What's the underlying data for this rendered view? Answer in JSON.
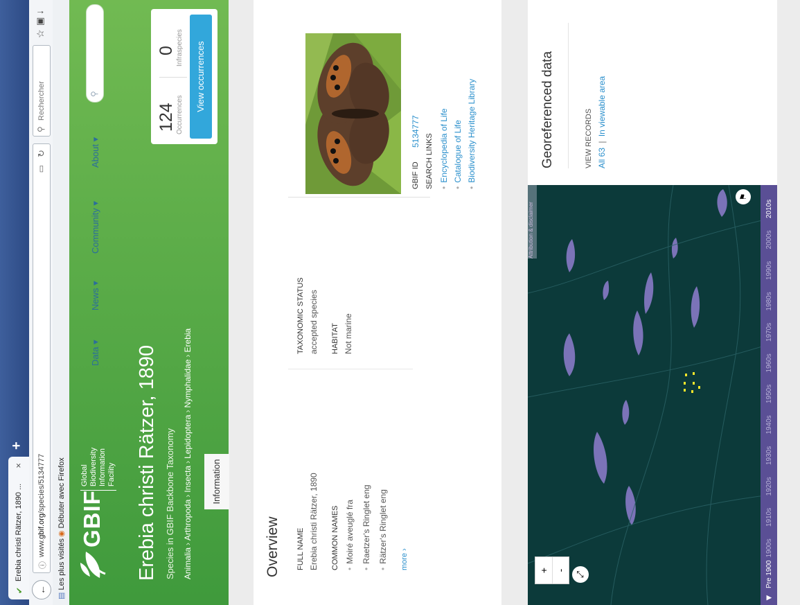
{
  "browser": {
    "tab_title": "Erebia christi Rätzer, 1890 ...",
    "tab_close": "×",
    "new_tab": "+",
    "url_prefix": "www.",
    "url_domain": "gbif.org",
    "url_path": "/species/5134777",
    "search_placeholder": "Rechercher",
    "bookmarks": [
      "Les plus visités",
      "Débuter avec Firefox"
    ]
  },
  "header": {
    "logo_text": "GBIF",
    "logo_name_line1": "Global Biodiversity",
    "logo_name_line2": "Information Facility",
    "nav": [
      "Data ▾",
      "News ▾",
      "Community ▾",
      "About ▾"
    ],
    "species_title": "Erebia christi Rätzer, 1890",
    "subtitle": "Species in GBIF Backbone Taxonomy",
    "breadcrumbs": [
      "Animalia",
      "Arthropoda",
      "Insecta",
      "Lepidoptera",
      "Nymphalidae",
      "Erebia"
    ],
    "breadcrumb_sep": "›",
    "info_tab": "Information",
    "stats": {
      "occurrences_count": "124",
      "occurrences_label": "Occurrences",
      "infraspecies_count": "0",
      "infraspecies_label": "Infraspecies",
      "view_button": "View occurrences"
    }
  },
  "overview": {
    "title": "Overview",
    "full_name_label": "FULL NAME",
    "full_name": "Erebia christi Rätzer, 1890",
    "common_names_label": "COMMON NAMES",
    "common_names": [
      "Moiré aveuglé fra",
      "Raetzer's Ringlet eng",
      "Rätzer's Ringlet eng"
    ],
    "more": "more ›",
    "taxonomic_status_label": "TAXONOMIC STATUS",
    "taxonomic_status": "accepted species",
    "habitat_label": "HABITAT",
    "habitat": "Not marine",
    "gbif_id_label": "GBIF ID",
    "gbif_id": "5134777",
    "search_links_label": "SEARCH LINKS",
    "search_links": [
      "Encyclopedia of Life",
      "Catalogue of Life",
      "Biodiversity Heritage Library"
    ]
  },
  "map": {
    "zoom_in": "+",
    "zoom_out": "-",
    "attribution": "Attribution & disclaimer",
    "timeline": [
      "Pre 1900",
      "1900s",
      "1910s",
      "1920s",
      "1930s",
      "1940s",
      "1950s",
      "1960s",
      "1970s",
      "1980s",
      "1990s",
      "2000s",
      "2010s"
    ],
    "title": "Georeferenced data",
    "view_records_label": "VIEW RECORDS",
    "all_link": "All 63",
    "divider": "|",
    "viewable_link": "In viewable area"
  },
  "colors": {
    "header_green": "#4fa540",
    "link_blue": "#2a8fcc",
    "button_blue": "#32a7db",
    "map_bg": "#0c3a3a",
    "lake": "#7b73b8",
    "occurrence_dot": "#f5e62a",
    "timeline": "#5a4f95"
  }
}
